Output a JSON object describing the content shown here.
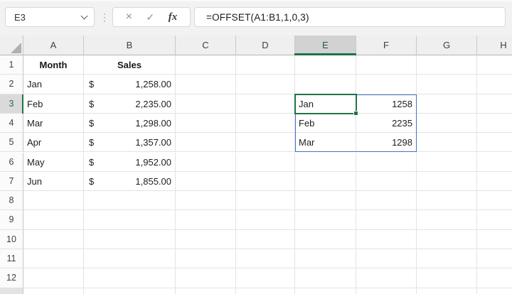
{
  "formula_bar": {
    "name_box_value": "E3",
    "formula": "=OFFSET(A1:B1,1,0,3)",
    "cancel_label": "×",
    "enter_label": "✓",
    "insert_function_label": "fx",
    "separator_glyph": "⋮"
  },
  "grid": {
    "column_headers": [
      "A",
      "B",
      "C",
      "D",
      "E",
      "F",
      "G",
      "H"
    ],
    "row_headers": [
      "1",
      "2",
      "3",
      "4",
      "5",
      "6",
      "7",
      "8",
      "9",
      "10",
      "11",
      "12"
    ],
    "active_cell": "E3",
    "selected_column_header": "E",
    "selected_row_header": "3",
    "spill_range": "E3:F5"
  },
  "cells": [
    {
      "ref": "A1",
      "text": "Month",
      "format": "header"
    },
    {
      "ref": "B1",
      "text": "Sales",
      "format": "header"
    },
    {
      "ref": "A2",
      "text": "Jan",
      "format": "text"
    },
    {
      "ref": "A3",
      "text": "Feb",
      "format": "text"
    },
    {
      "ref": "A4",
      "text": "Mar",
      "format": "text"
    },
    {
      "ref": "A5",
      "text": "Apr",
      "format": "text"
    },
    {
      "ref": "A6",
      "text": "May",
      "format": "text"
    },
    {
      "ref": "A7",
      "text": "Jun",
      "format": "text"
    },
    {
      "ref": "B2",
      "currency": "$",
      "text": "1,258.00",
      "format": "accounting"
    },
    {
      "ref": "B3",
      "currency": "$",
      "text": "2,235.00",
      "format": "accounting"
    },
    {
      "ref": "B4",
      "currency": "$",
      "text": "1,298.00",
      "format": "accounting"
    },
    {
      "ref": "B5",
      "currency": "$",
      "text": "1,357.00",
      "format": "accounting"
    },
    {
      "ref": "B6",
      "currency": "$",
      "text": "1,952.00",
      "format": "accounting"
    },
    {
      "ref": "B7",
      "currency": "$",
      "text": "1,855.00",
      "format": "accounting"
    },
    {
      "ref": "E3",
      "text": "Jan",
      "format": "text"
    },
    {
      "ref": "F3",
      "text": "1258",
      "format": "number"
    },
    {
      "ref": "E4",
      "text": "Feb",
      "format": "text"
    },
    {
      "ref": "F4",
      "text": "2235",
      "format": "number"
    },
    {
      "ref": "E5",
      "text": "Mar",
      "format": "text"
    },
    {
      "ref": "F5",
      "text": "1298",
      "format": "number"
    }
  ],
  "colors": {
    "accent_green": "#217346",
    "spill_border_blue": "#4472c4",
    "selected_header_bg": "#d2d2d2",
    "header_bg": "#efefef",
    "gridline": "#e3e3e3"
  }
}
